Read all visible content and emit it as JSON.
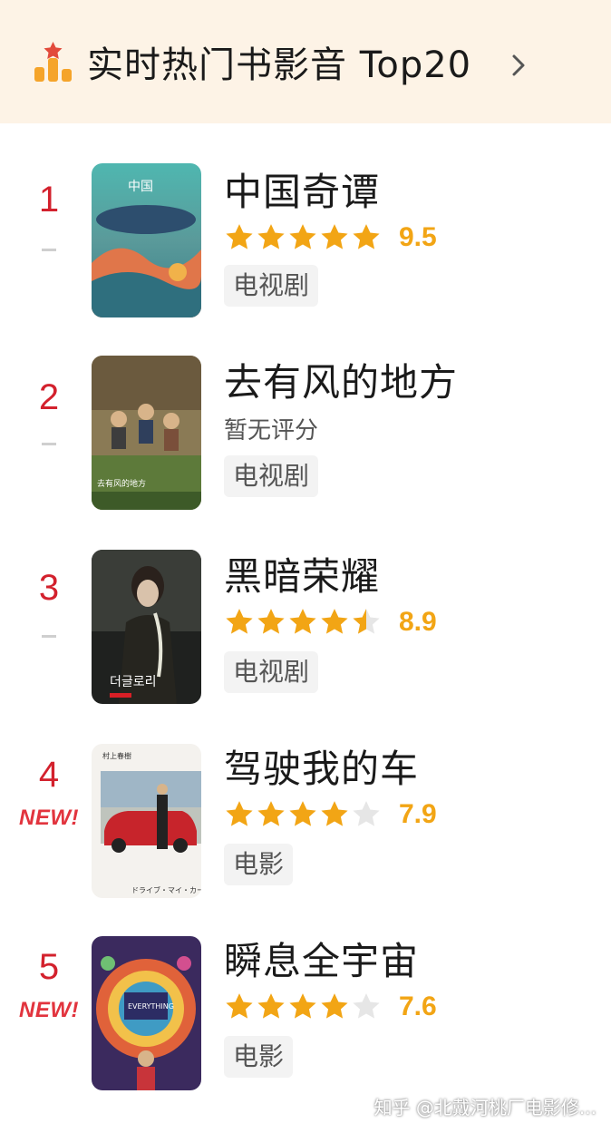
{
  "header": {
    "title": "实时热门书影音 Top20",
    "icon": "ranking-chart-icon",
    "chevron": "chevron-right-icon",
    "colors": {
      "background": "#fdf3e6",
      "icon_orange": "#f5a42a",
      "icon_red": "#e24a3b"
    }
  },
  "items": [
    {
      "rank": "1",
      "trend": "—",
      "is_new": false,
      "title": "中国奇谭",
      "rating_stars": 5.0,
      "score": "9.5",
      "score_text": "",
      "tag": "电视剧"
    },
    {
      "rank": "2",
      "trend": "—",
      "is_new": false,
      "title": "去有风的地方",
      "rating_stars": 0,
      "score": "",
      "score_text": "暂无评分",
      "tag": "电视剧"
    },
    {
      "rank": "3",
      "trend": "—",
      "is_new": false,
      "title": "黑暗荣耀",
      "rating_stars": 4.5,
      "score": "8.9",
      "score_text": "",
      "tag": "电视剧"
    },
    {
      "rank": "4",
      "trend": "",
      "is_new": true,
      "new_label": "NEW!",
      "title": "驾驶我的车",
      "rating_stars": 4.0,
      "score": "7.9",
      "score_text": "",
      "tag": "电影"
    },
    {
      "rank": "5",
      "trend": "",
      "is_new": true,
      "new_label": "NEW!",
      "title": "瞬息全宇宙",
      "rating_stars": 4.0,
      "score": "7.6",
      "score_text": "",
      "tag": "电影"
    }
  ],
  "colors": {
    "rank_red": "#d3212d",
    "star_filled": "#f2a515",
    "star_empty": "#e6e6e6",
    "score": "#f2a515",
    "new_badge": "#e2343e",
    "tag_bg": "#f3f3f3"
  },
  "watermark": "知乎 @北戴河桃厂电影修..."
}
